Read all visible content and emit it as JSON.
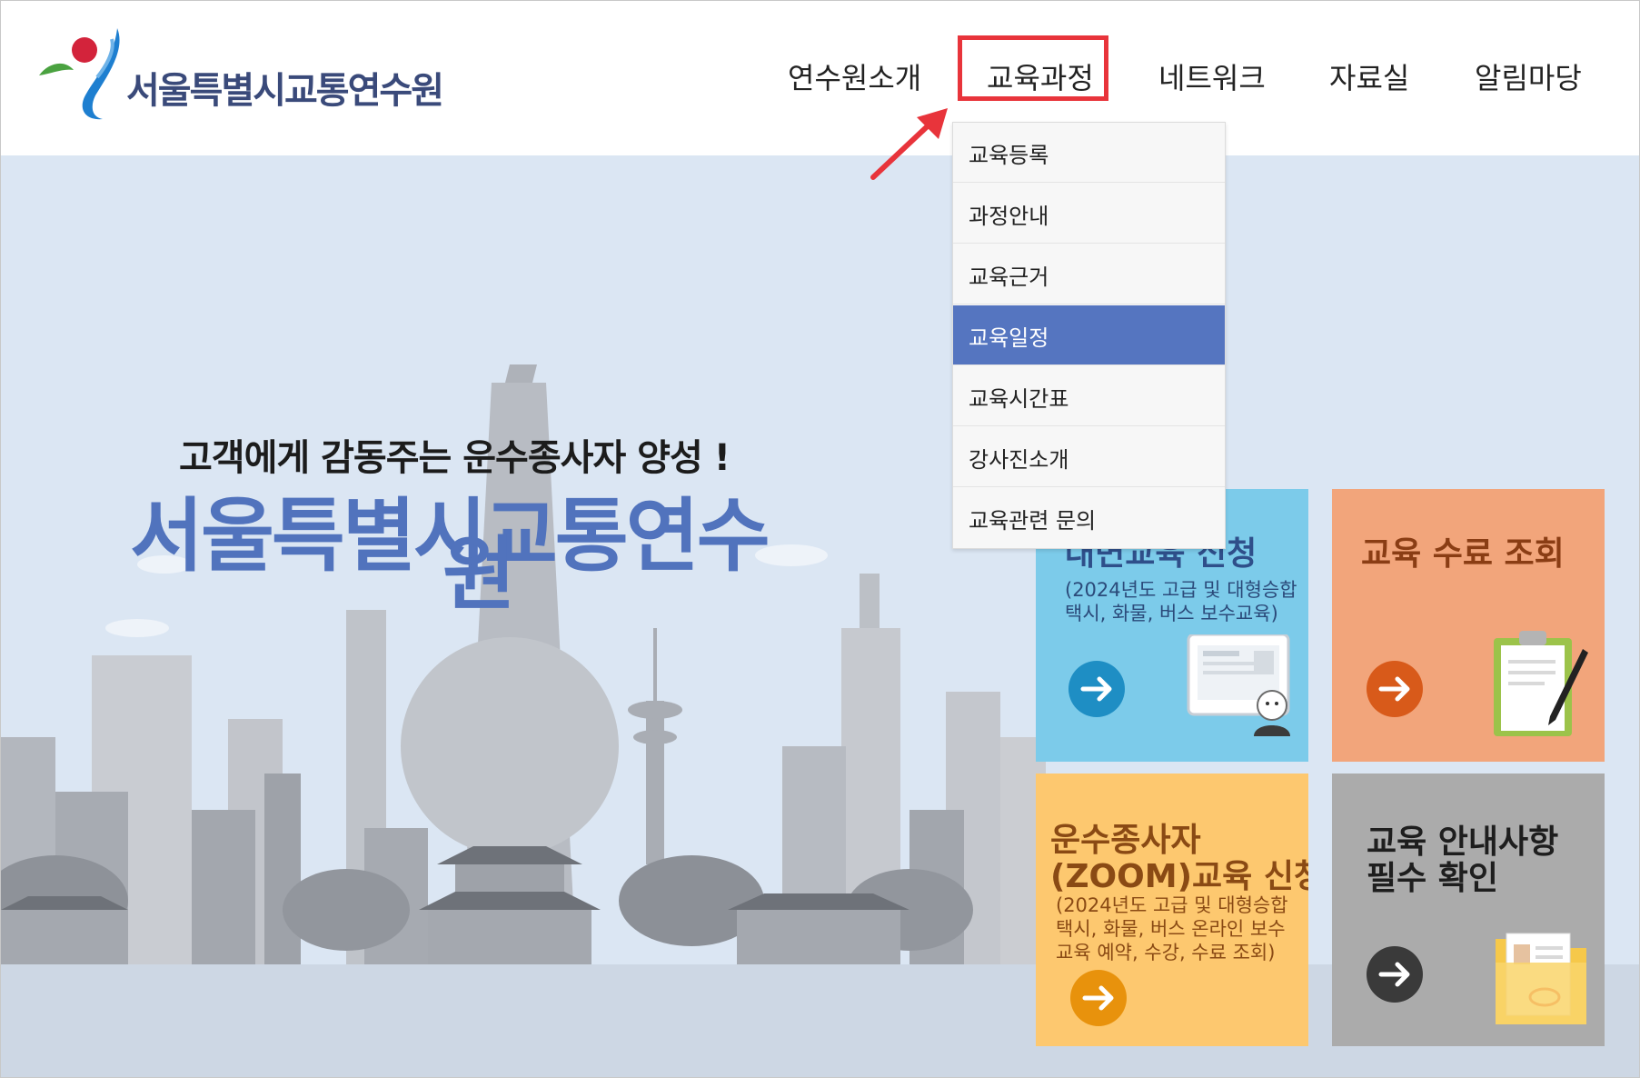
{
  "header": {
    "logo_text": "서울특별시교통연수원",
    "nav": [
      "연수원소개",
      "교육과정",
      "네트워크",
      "자료실",
      "알림마당"
    ]
  },
  "dropdown": {
    "items": [
      "교육등록",
      "과정안내",
      "교육근거",
      "교육일정",
      "교육시간표",
      "강사진소개",
      "교육관련 문의"
    ],
    "active_index": 3
  },
  "hero": {
    "slogan": "고객에게 감동주는 운수종사자 양성 !",
    "title_part1": "서울특별시",
    "title_part2": "교통연수",
    "title_part3": "원"
  },
  "tiles": [
    {
      "title": "대면교육 신청",
      "subtitle": "(2024년도 고급 및 대형승합\n택시, 화물, 버스 보수교육)"
    },
    {
      "title": "교육 수료 조회",
      "subtitle": ""
    },
    {
      "title_line1": "운수종사자",
      "title_line2": "(ZOOM)교육 신청",
      "subtitle": "(2024년도 고급 및 대형승합\n택시, 화물, 버스 온라인 보수\n교육 예약, 수강, 수료 조회)"
    },
    {
      "title_line1": "교육 안내사항",
      "title_line2": "필수 확인",
      "subtitle": ""
    }
  ],
  "colors": {
    "accent_blue": "#5575c0",
    "highlight_red": "#e8343b",
    "hero_bg": "#dbe6f3",
    "tile_blue": "#7ccbea",
    "tile_orange": "#f2a57b",
    "tile_yellow": "#fdc86f",
    "tile_gray": "#ababab"
  },
  "icons": [
    "seoul-logo-icon",
    "arrow-right-icon",
    "monitor-person-icon",
    "clipboard-pen-icon",
    "folder-document-icon",
    "callout-arrow-icon"
  ]
}
